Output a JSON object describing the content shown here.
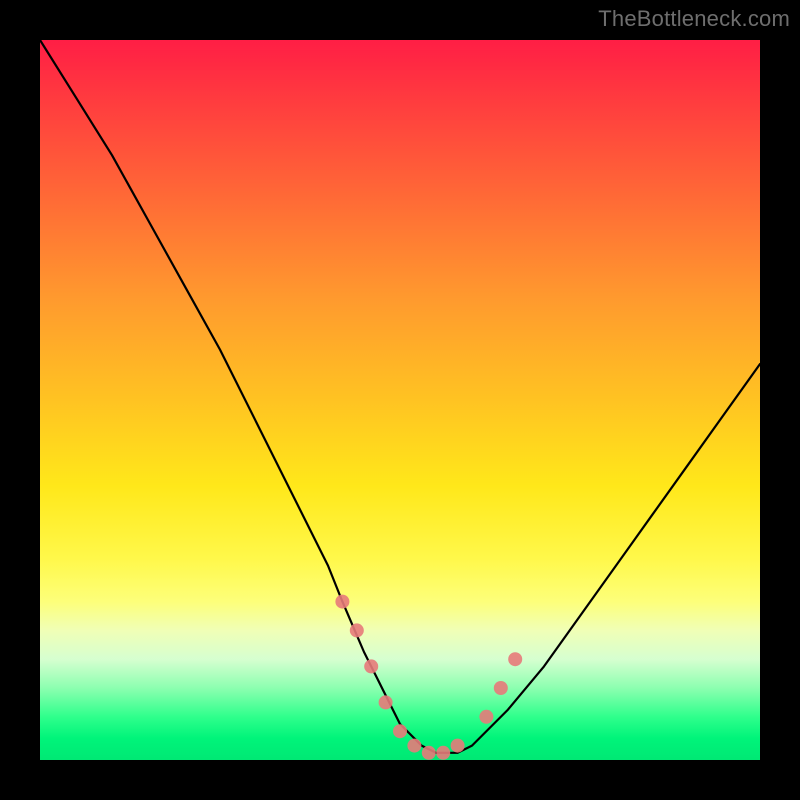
{
  "watermark": "TheBottleneck.com",
  "colors": {
    "background": "#000000",
    "curve": "#000000",
    "marker": "#e77a7a",
    "watermark": "#6e6e6e"
  },
  "chart_data": {
    "type": "line",
    "title": "",
    "xlabel": "",
    "ylabel": "",
    "xlim": [
      0,
      100
    ],
    "ylim": [
      0,
      100
    ],
    "grid": false,
    "legend": false,
    "series": [
      {
        "name": "bottleneck-curve",
        "x": [
          0,
          5,
          10,
          15,
          20,
          25,
          30,
          35,
          40,
          42,
          45,
          47,
          50,
          53,
          55,
          58,
          60,
          65,
          70,
          75,
          80,
          85,
          90,
          95,
          100
        ],
        "values": [
          100,
          92,
          84,
          75,
          66,
          57,
          47,
          37,
          27,
          22,
          15,
          11,
          5,
          2,
          1,
          1,
          2,
          7,
          13,
          20,
          27,
          34,
          41,
          48,
          55
        ]
      }
    ],
    "markers": {
      "name": "highlight-dots",
      "x": [
        42,
        44,
        46,
        48,
        50,
        52,
        54,
        56,
        58,
        62,
        64,
        66
      ],
      "values": [
        22,
        18,
        13,
        8,
        4,
        2,
        1,
        1,
        2,
        6,
        10,
        14
      ]
    },
    "background_gradient_top_to_bottom": [
      {
        "stop": 0,
        "color": "#ff1e45"
      },
      {
        "stop": 50,
        "color": "#ffc322"
      },
      {
        "stop": 78,
        "color": "#fdff7a"
      },
      {
        "stop": 100,
        "color": "#00e874"
      }
    ]
  }
}
